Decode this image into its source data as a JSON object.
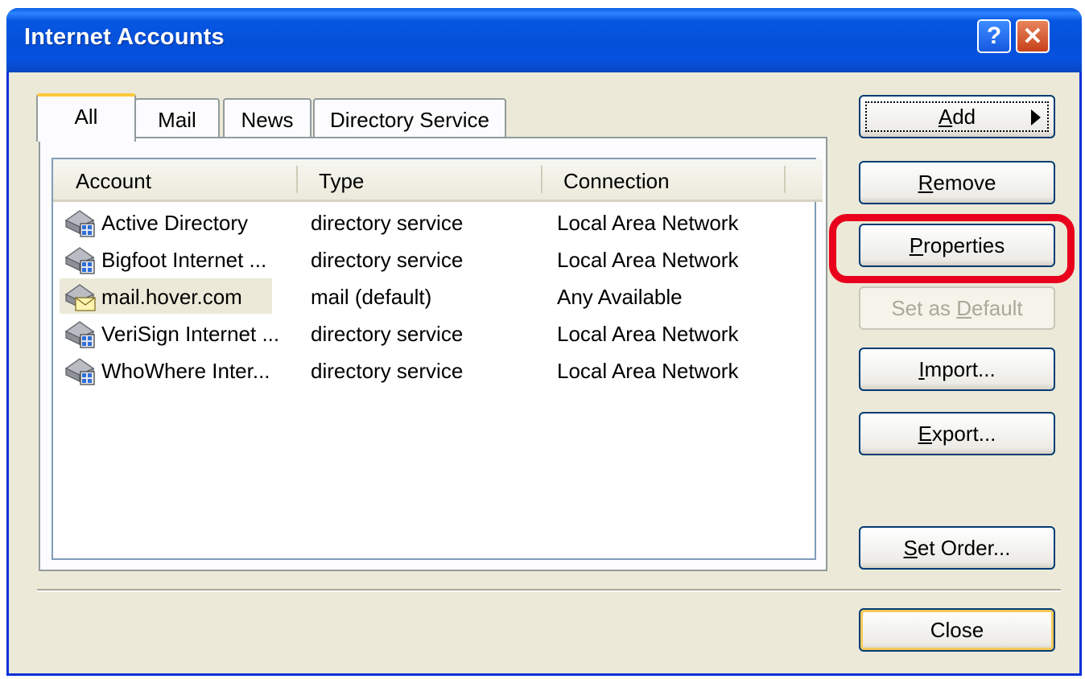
{
  "window": {
    "title": "Internet Accounts",
    "help_label": "?",
    "close_label": "✕"
  },
  "tabs": [
    {
      "label": "All",
      "active": true
    },
    {
      "label": "Mail",
      "active": false
    },
    {
      "label": "News",
      "active": false
    },
    {
      "label": "Directory Service",
      "active": false
    }
  ],
  "list": {
    "columns": [
      "Account",
      "Type",
      "Connection"
    ],
    "rows": [
      {
        "account": "Active Directory",
        "type": "directory service",
        "connection": "Local Area Network",
        "icon": "directory-service-icon"
      },
      {
        "account": "Bigfoot Internet ...",
        "type": "directory service",
        "connection": "Local Area Network",
        "icon": "directory-service-icon"
      },
      {
        "account": "mail.hover.com",
        "type": "mail (default)",
        "connection": "Any Available",
        "icon": "mail-account-icon",
        "selected": true
      },
      {
        "account": "VeriSign Internet ...",
        "type": "directory service",
        "connection": "Local Area Network",
        "icon": "directory-service-icon"
      },
      {
        "account": "WhoWhere Inter...",
        "type": "directory service",
        "connection": "Local Area Network",
        "icon": "directory-service-icon"
      }
    ]
  },
  "buttons": {
    "add": {
      "pre": "",
      "key": "A",
      "post": "dd"
    },
    "remove": {
      "pre": "",
      "key": "R",
      "post": "emove"
    },
    "properties": {
      "pre": "",
      "key": "P",
      "post": "roperties"
    },
    "set_default": {
      "pre": "Set as ",
      "key": "D",
      "post": "efault"
    },
    "import": {
      "pre": "",
      "key": "I",
      "post": "mport..."
    },
    "export": {
      "pre": "",
      "key": "E",
      "post": "xport..."
    },
    "set_order": {
      "pre": "",
      "key": "S",
      "post": "et Order..."
    },
    "close": {
      "label": "Close"
    }
  },
  "colors": {
    "highlight": "#e8001c",
    "titlebar": "#0550d9",
    "dialog_bg": "#ece9d8"
  }
}
